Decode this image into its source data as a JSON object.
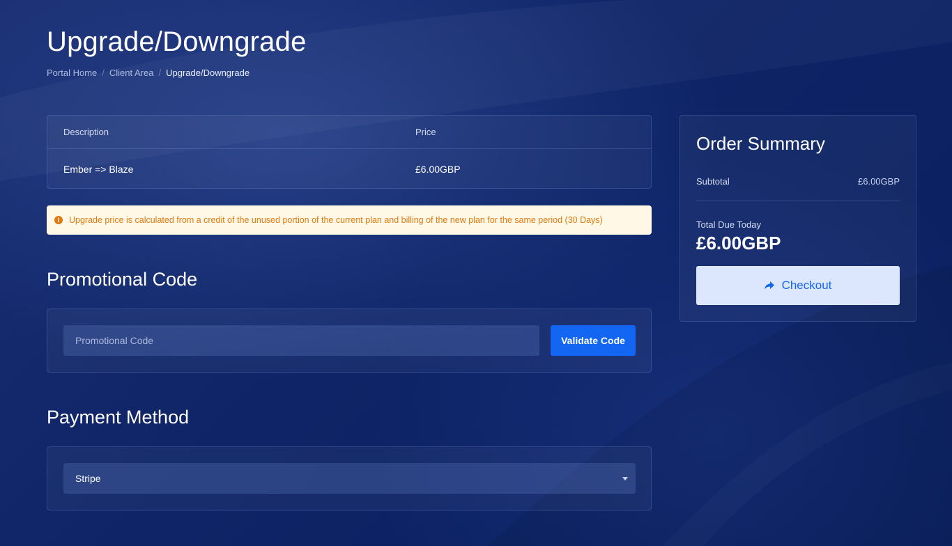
{
  "page": {
    "title": "Upgrade/Downgrade",
    "breadcrumb": [
      "Portal Home",
      "Client Area",
      "Upgrade/Downgrade"
    ],
    "breadcrumb_separator": "/"
  },
  "items_table": {
    "headers": {
      "description": "Description",
      "price": "Price"
    },
    "rows": [
      {
        "description": "Ember => Blaze",
        "price": "£6.00GBP"
      }
    ]
  },
  "alert": {
    "icon": "info-circle-icon",
    "text": "Upgrade price is calculated from a credit of the unused portion of the current plan and billing of the new plan for the same period (30 Days)",
    "color": "#e07a10",
    "background": "#fff8e6"
  },
  "promo": {
    "section_title": "Promotional Code",
    "input_placeholder": "Promotional Code",
    "input_value": "",
    "button_label": "Validate Code"
  },
  "payment": {
    "section_title": "Payment Method",
    "selected": "Stripe"
  },
  "summary": {
    "title": "Order Summary",
    "subtotal_label": "Subtotal",
    "subtotal_value": "£6.00GBP",
    "total_label": "Total Due Today",
    "total_value": "£6.00GBP",
    "checkout_label": "Checkout",
    "checkout_icon": "share-arrow-icon"
  },
  "colors": {
    "accent": "#1266f1",
    "checkout_bg": "#dce7fd",
    "background": "#0e2466"
  }
}
